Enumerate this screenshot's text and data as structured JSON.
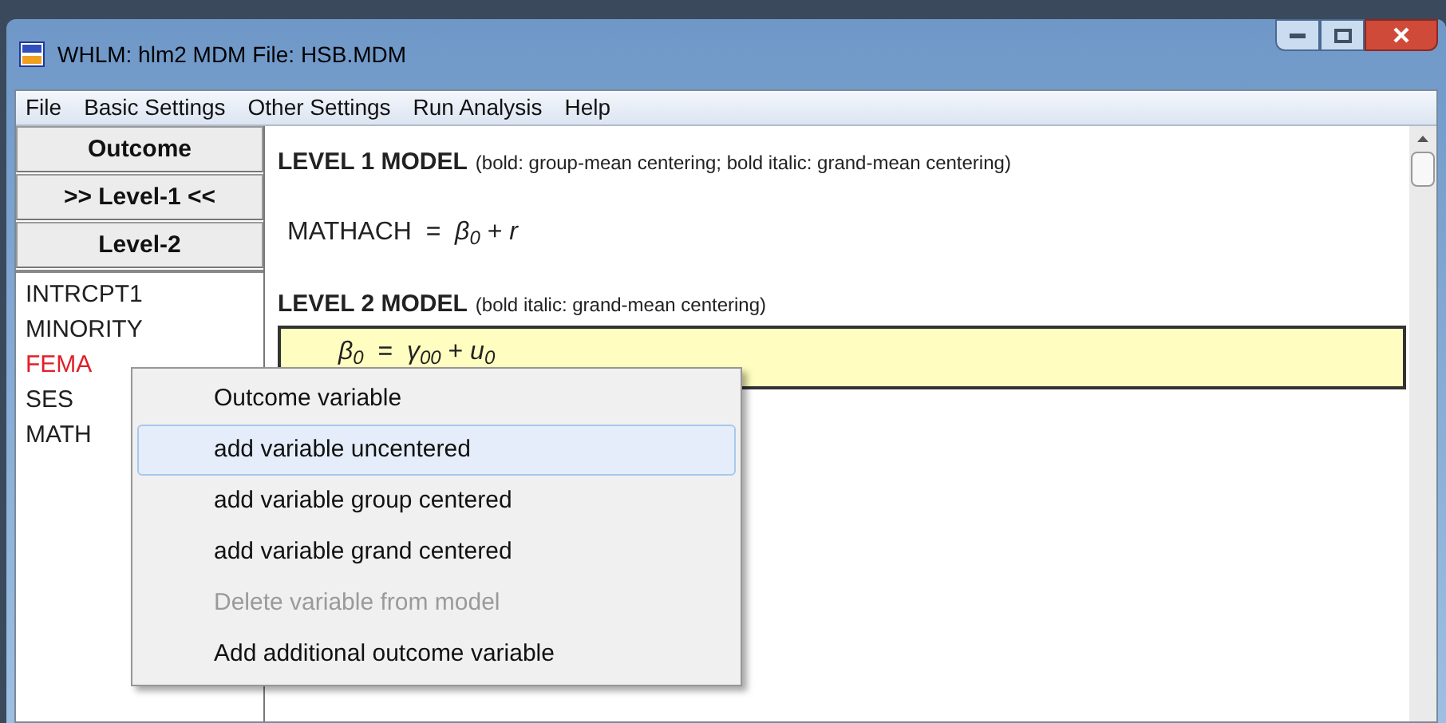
{
  "window": {
    "title": "WHLM: hlm2 MDM File: HSB.MDM"
  },
  "menu_bar": [
    "File",
    "Basic Settings",
    "Other Settings",
    "Run Analysis",
    "Help"
  ],
  "level_buttons": [
    "Outcome",
    ">> Level-1 <<",
    "Level-2"
  ],
  "variables": [
    {
      "name": "INTRCPT1",
      "color": "#202020"
    },
    {
      "name": "MINORITY",
      "color": "#202020"
    },
    {
      "name": "FEMA",
      "color": "#e0202a"
    },
    {
      "name": "SES",
      "color": "#202020"
    },
    {
      "name": "MATH",
      "color": "#202020"
    }
  ],
  "level1": {
    "heading": "LEVEL 1 MODEL",
    "note": "(bold: group-mean centering; bold italic: grand-mean centering)",
    "equation": "MATHACH  =  *β*$_{0}$ + *r*"
  },
  "level2": {
    "heading": "LEVEL 2 MODEL",
    "note": "(bold italic: grand-mean centering)",
    "equation": "*β*$_{0}$  =  *γ*$_{00}$ + *u*$_{0}$"
  },
  "context_menu": [
    {
      "label": "Outcome variable",
      "selected": false,
      "disabled": false
    },
    {
      "label": "add variable uncentered",
      "selected": true,
      "disabled": false
    },
    {
      "label": "add variable group centered",
      "selected": false,
      "disabled": false
    },
    {
      "label": "add variable grand centered",
      "selected": false,
      "disabled": false
    },
    {
      "label": "Delete variable from model",
      "selected": false,
      "disabled": true
    },
    {
      "label": "Add additional outcome variable",
      "selected": false,
      "disabled": false
    }
  ]
}
